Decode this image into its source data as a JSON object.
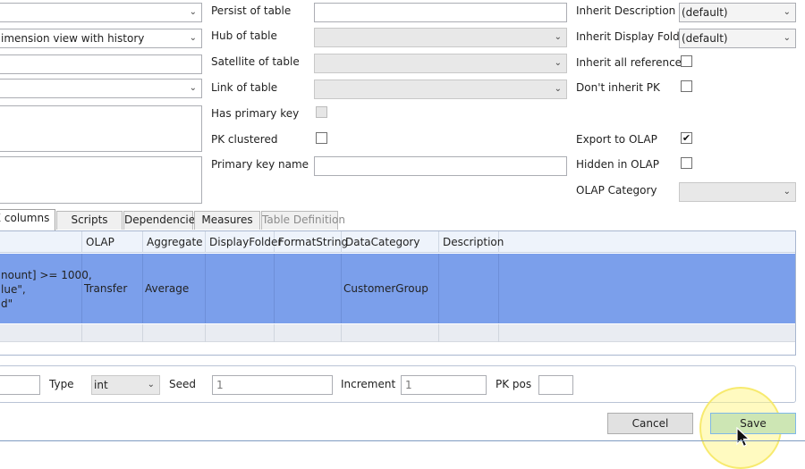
{
  "left_column": {
    "type_value": "",
    "view_value": "imension view with history",
    "textbox1_value": "",
    "combo3_value": ""
  },
  "mid_column": {
    "persist_label": "Persist of table",
    "hub_label": "Hub of table",
    "satellite_label": "Satellite of table",
    "link_label": "Link of table",
    "has_pk_label": "Has primary key",
    "pk_clustered_label": "PK clustered",
    "pk_name_label": "Primary key name"
  },
  "right_column": {
    "inherit_desc_label": "Inherit Description",
    "inherit_desc_value": "(default)",
    "inherit_folder_label": "Inherit Display Folder",
    "inherit_folder_value": "(default)",
    "inherit_refs_label": "Inherit all references",
    "dont_inherit_pk_label": "Don't inherit PK",
    "export_olap_label": "Export to OLAP",
    "export_olap_checked": true,
    "hidden_olap_label": "Hidden in OLAP",
    "olap_category_label": "OLAP Category",
    "olap_category_value": ""
  },
  "tabs": [
    {
      "label": "AX columns",
      "active": true,
      "disabled": false
    },
    {
      "label": "Scripts",
      "active": false,
      "disabled": false
    },
    {
      "label": "Dependencies",
      "active": false,
      "disabled": false
    },
    {
      "label": "Measures",
      "active": false,
      "disabled": false
    },
    {
      "label": "Table Definition",
      "active": false,
      "disabled": true
    }
  ],
  "grid": {
    "headers": [
      "",
      "OLAP",
      "Aggregate",
      "DisplayFolder",
      "FormatString",
      "DataCategory",
      "Description"
    ],
    "selected_row": {
      "expr_line1": "nount] >= 1000,",
      "expr_line2": "lue\",",
      "expr_line3": "d\"",
      "olap": "Transfer",
      "aggregate": "Average",
      "display_folder": "",
      "format_string": "",
      "data_category": "CustomerGroup",
      "description": ""
    }
  },
  "identity": {
    "first_value": "",
    "type_label": "Type",
    "type_value": "int",
    "seed_label": "Seed",
    "seed_value": "1",
    "increment_label": "Increment",
    "increment_value": "1",
    "pkpos_label": "PK pos",
    "pkpos_value": ""
  },
  "buttons": {
    "cancel_label": "Cancel",
    "save_label": "Save"
  },
  "colors": {
    "selection": "#7b9feb",
    "header_bg": "#eef3fb",
    "highlight": "#fff9a8"
  }
}
